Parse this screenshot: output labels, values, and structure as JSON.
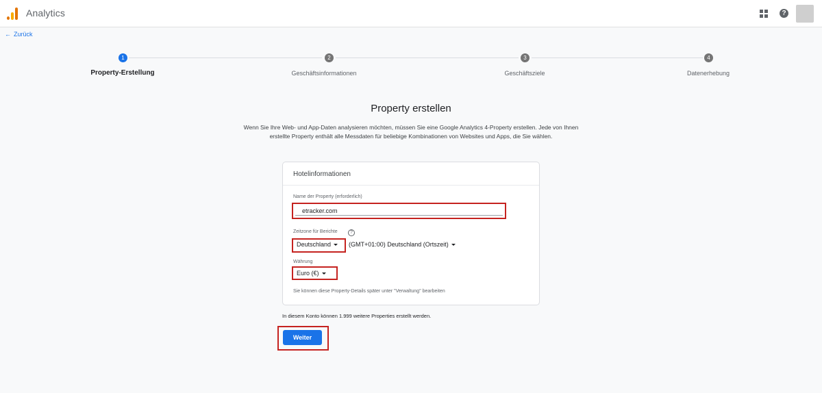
{
  "header": {
    "app_title": "Analytics",
    "logo_icon": "analytics-logo-icon",
    "apps_icon": "apps-grid-icon",
    "help_icon": "help-icon",
    "help_glyph": "?"
  },
  "nav": {
    "back_arrow": "←",
    "back_label": "Zurück"
  },
  "stepper": {
    "steps": [
      {
        "number": "1",
        "label": "Property-Erstellung",
        "active": true
      },
      {
        "number": "2",
        "label": "Geschäftsinformationen",
        "active": false
      },
      {
        "number": "3",
        "label": "Geschäftsziele",
        "active": false
      },
      {
        "number": "4",
        "label": "Datenerhebung",
        "active": false
      }
    ]
  },
  "main": {
    "title": "Property erstellen",
    "description": "Wenn Sie Ihre Web- und App-Daten analysieren möchten, müssen Sie eine Google Analytics 4-Property erstellen. Jede von Ihnen erstellte Property enthält alle Messdaten für beliebige Kombinationen von Websites und Apps, die Sie wählen."
  },
  "card": {
    "title": "Hotelinformationen",
    "property_name_label": "Name der Property (erforderlich)",
    "property_name_value": "etracker.com",
    "timezone_label": "Zeitzone für Berichte",
    "timezone_help_glyph": "?",
    "timezone_country": "Deutschland",
    "timezone_value": "(GMT+01:00) Deutschland (Ortszeit)",
    "currency_label": "Währung",
    "currency_value": "Euro (€)",
    "note": "Sie können diese Property-Details später unter \"Verwaltung\" bearbeiten"
  },
  "footer": {
    "quota_text": "In diesem Konto können 1.999 weitere Properties erstellt werden.",
    "next_label": "Weiter"
  },
  "colors": {
    "accent": "#1a73e8",
    "highlight_border": "#c5221f",
    "inactive_step": "#757575"
  }
}
